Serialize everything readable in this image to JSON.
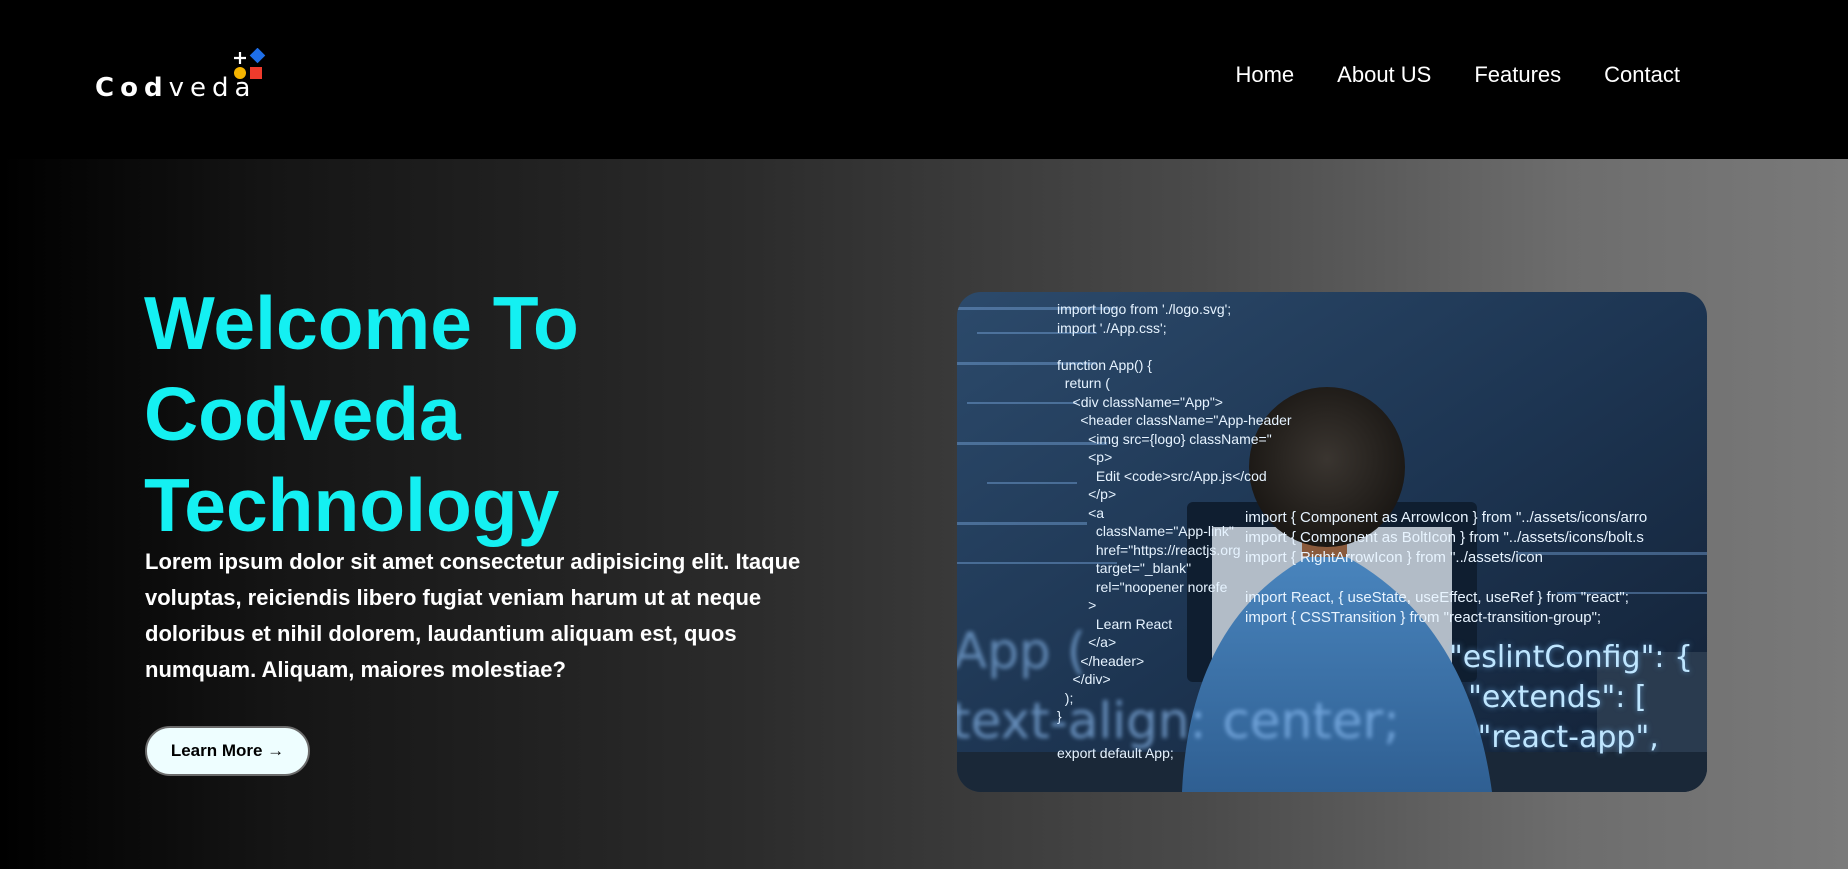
{
  "brand": {
    "name_bold": "Cod",
    "name_light": "veda"
  },
  "nav": {
    "items": [
      {
        "label": "Home"
      },
      {
        "label": "About US"
      },
      {
        "label": "Features"
      },
      {
        "label": "Contact"
      }
    ]
  },
  "hero": {
    "title_line1": "Welcome To Codveda",
    "title_line2": "Technology",
    "description": "Lorem ipsum dolor sit amet consectetur adipisicing elit. Itaque voluptas, reiciendis libero fugiat veniam harum ut at neque doloribus et nihil dolorem, laudantium aliquam est, quos numquam. Aliquam, maiores molestiae?",
    "cta_label": "Learn More →"
  },
  "image": {
    "code_left": "import logo from './logo.svg';\nimport './App.css';\n\nfunction App() {\n  return (\n    <div className=\"App\">\n      <header className=\"App-header\n        <img src={logo} className=\"\n        <p>\n          Edit <code>src/App.js</cod\n        </p>\n        <a\n          className=\"App-link\"\n          href=\"https://reactjs.org\n          target=\"_blank\"\n          rel=\"noopener norefe\n        >\n          Learn React\n        </a>\n      </header>\n    </div>\n  );\n}\n\nexport default App;",
    "code_right": "import { Component as ArrowIcon } from \"../assets/icons/arro\nimport { Component as BoltIcon } from \"../assets/icons/bolt.s\nimport { RightArrowIcon } from \"../assets/icon\n\nimport React, { useState, useEffect, useRef } from \"react\";\nimport { CSSTransition } from \"react-transition-group\";",
    "code_json": "\"eslintConfig\": {\n  \"extends\": [\n   \"react-app\",",
    "code_big1": "App (",
    "code_big2": "text-align: center;"
  },
  "colors": {
    "accent": "#14f0f2",
    "header_bg": "#000000",
    "logo_blue": "#1e6ee8",
    "logo_yellow": "#f5b400",
    "logo_red": "#ef3b2c"
  }
}
